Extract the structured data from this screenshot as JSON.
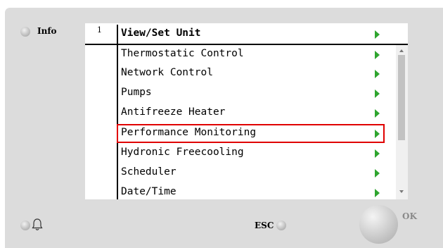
{
  "panel": {
    "info_label": "Info",
    "esc_label": "ESC",
    "ok_label": "OK",
    "bell_icon": "bell-icon"
  },
  "menu": {
    "number": "1",
    "title": "View/Set Unit",
    "selected_index": 4,
    "items": [
      "Thermostatic Control",
      "Network Control",
      "Pumps",
      "Antifreeze Heater",
      "Performance Monitoring",
      "Hydronic Freecooling",
      "Scheduler",
      "Date/Time"
    ]
  },
  "colors": {
    "arrow": "#2ea52e",
    "selection_border": "#e00000",
    "panel_background": "#dcdcdc"
  }
}
